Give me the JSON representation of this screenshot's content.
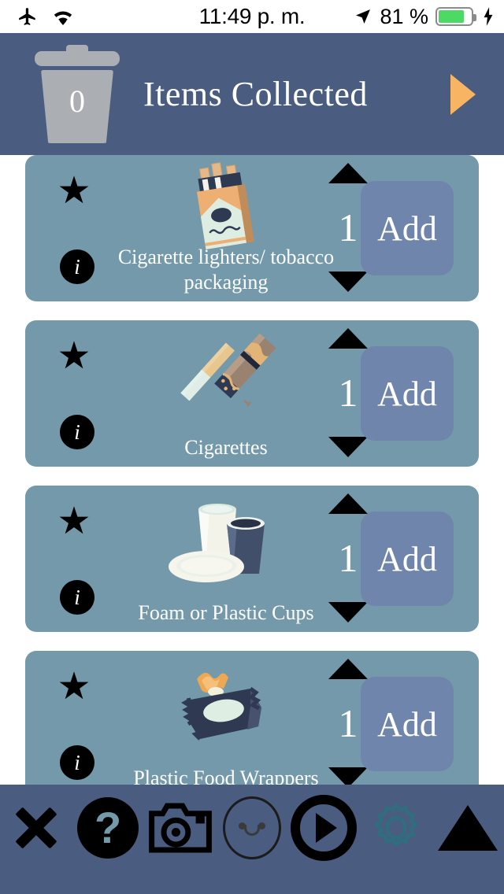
{
  "statusbar": {
    "airplane_icon": "airplane-icon",
    "wifi_icon": "wifi-icon",
    "time": "11:49 p. m.",
    "location_icon": "location-arrow-icon",
    "battery_percent": "81 %",
    "battery_level": 81,
    "battery_color": "#4CD964",
    "charging_icon": "charging-bolt-icon"
  },
  "header": {
    "trash_icon": "trash-can-icon",
    "collected_count": "0",
    "title": "Items Collected",
    "next_icon": "play-triangle-icon",
    "next_color": "#F9B463",
    "background": "#4a5c80"
  },
  "theme": {
    "page_background": "#ffffff",
    "card_background": "#7499ab",
    "add_button_background": "#6f85ac",
    "text_on_card": "#ffffff",
    "icon_black": "#000000",
    "gear_teal": "#2f6e80"
  },
  "items": [
    {
      "favorite_icon": "star-icon",
      "info_icon": "info-icon",
      "artwork": "cigarette-pack-icon",
      "label": "Cigarette lighters/ tobacco packaging",
      "label_line1": "Cigarette lighters/",
      "label_line2": "tobacco packaging",
      "increment_icon": "triangle-up-icon",
      "decrement_icon": "triangle-down-icon",
      "quantity": "1",
      "add_label": "Add"
    },
    {
      "favorite_icon": "star-icon",
      "info_icon": "info-icon",
      "artwork": "cigarette-cigar-icon",
      "label": "Cigarettes",
      "label_line1": "Cigarettes",
      "label_line2": "",
      "increment_icon": "triangle-up-icon",
      "decrement_icon": "triangle-down-icon",
      "quantity": "1",
      "add_label": "Add"
    },
    {
      "favorite_icon": "star-icon",
      "info_icon": "info-icon",
      "artwork": "foam-cups-icon",
      "label": "Foam or Plastic Cups",
      "label_line1": "Foam or Plastic Cups",
      "label_line2": "",
      "increment_icon": "triangle-up-icon",
      "decrement_icon": "triangle-down-icon",
      "quantity": "1",
      "add_label": "Add"
    },
    {
      "favorite_icon": "star-icon",
      "info_icon": "info-icon",
      "artwork": "food-wrapper-icon",
      "label": "Plastic Food Wrappers",
      "label_line1": "Plastic Food Wrappers",
      "label_line2": "",
      "increment_icon": "triangle-up-icon",
      "decrement_icon": "triangle-down-icon",
      "quantity": "1",
      "add_label": "Add"
    }
  ],
  "toolbar": {
    "close_icon": "close-x-icon",
    "help_icon": "help-question-icon",
    "camera_icon": "camera-icon",
    "mood_icon": "smiley-face-icon",
    "play_icon": "play-circle-icon",
    "settings_icon": "gear-icon",
    "scroll_up_icon": "triangle-up-icon"
  }
}
